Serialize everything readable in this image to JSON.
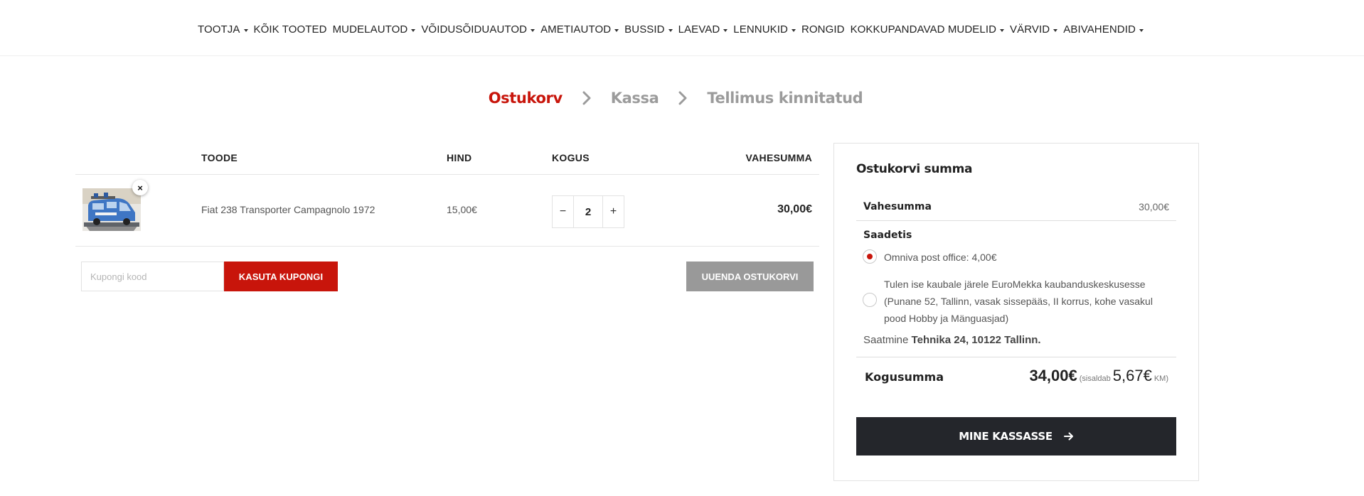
{
  "nav": {
    "items": [
      {
        "label": "TOOTJA",
        "dropdown": true
      },
      {
        "label": "KÕIK TOOTED",
        "dropdown": false
      },
      {
        "label": "MUDELAUTOD",
        "dropdown": true
      },
      {
        "label": "VÕIDUSÕIDUAUTOD",
        "dropdown": true
      },
      {
        "label": "AMETIAUTOD",
        "dropdown": true
      },
      {
        "label": "BUSSID",
        "dropdown": true
      },
      {
        "label": "LAEVAD",
        "dropdown": true
      },
      {
        "label": "LENNUKID",
        "dropdown": true
      },
      {
        "label": "RONGID",
        "dropdown": false
      },
      {
        "label": "KOKKUPANDAVAD MUDELID",
        "dropdown": true
      },
      {
        "label": "VÄRVID",
        "dropdown": true
      },
      {
        "label": "ABIVAHENDID",
        "dropdown": true
      }
    ]
  },
  "steps": [
    {
      "label": "Ostukorv",
      "active": true
    },
    {
      "label": "Kassa",
      "active": false
    },
    {
      "label": "Tellimus kinnitatud",
      "active": false
    }
  ],
  "cart": {
    "headers": {
      "product": "TOODE",
      "price": "HIND",
      "quantity": "KOGUS",
      "subtotal": "VAHESUMMA"
    },
    "items": [
      {
        "name": "Fiat 238 Transporter Campagnolo 1972",
        "price": "15,00€",
        "quantity": "2",
        "subtotal": "30,00€",
        "remove_symbol": "×"
      }
    ],
    "qty_minus": "−",
    "qty_plus": "+",
    "coupon_placeholder": "Kupongi kood",
    "apply_coupon_label": "KASUTA KUPONGI",
    "update_cart_label": "UUENDA OSTUKORVI"
  },
  "totals": {
    "title": "Ostukorvi summa",
    "subtotal_label": "Vahesumma",
    "subtotal_value": "30,00€",
    "shipping_label": "Saadetis",
    "shipping_options": [
      {
        "label": "Omniva post office: 4,00€",
        "checked": true
      },
      {
        "label": "Tulen ise kaubale järele EuroMekka kaubanduskeskusesse (Punane 52, Tallinn, vasak sissepääs, II korrus, kohe vasakul pood Hobby ja Mänguasjad)",
        "checked": false
      }
    ],
    "ship_to_prefix": "Saatmine",
    "ship_to_address": "Tehnika 24, 10122 Tallinn.",
    "total_label": "Kogusumma",
    "total_value": "34,00€",
    "tax_prefix": "(sisaldab",
    "tax_value": "5,67€",
    "tax_suffix": "KM)",
    "checkout_label": "MINE KASSASSE"
  },
  "colors": {
    "accent": "#c8150b",
    "inactive_step": "#9b9b9b",
    "dark_button": "#24262b",
    "grey_button": "#999999"
  },
  "icons": [
    "caret-down-icon",
    "chevron-right-icon",
    "close-icon",
    "minus-icon",
    "plus-icon",
    "arrow-right-icon",
    "product-thumbnail"
  ]
}
